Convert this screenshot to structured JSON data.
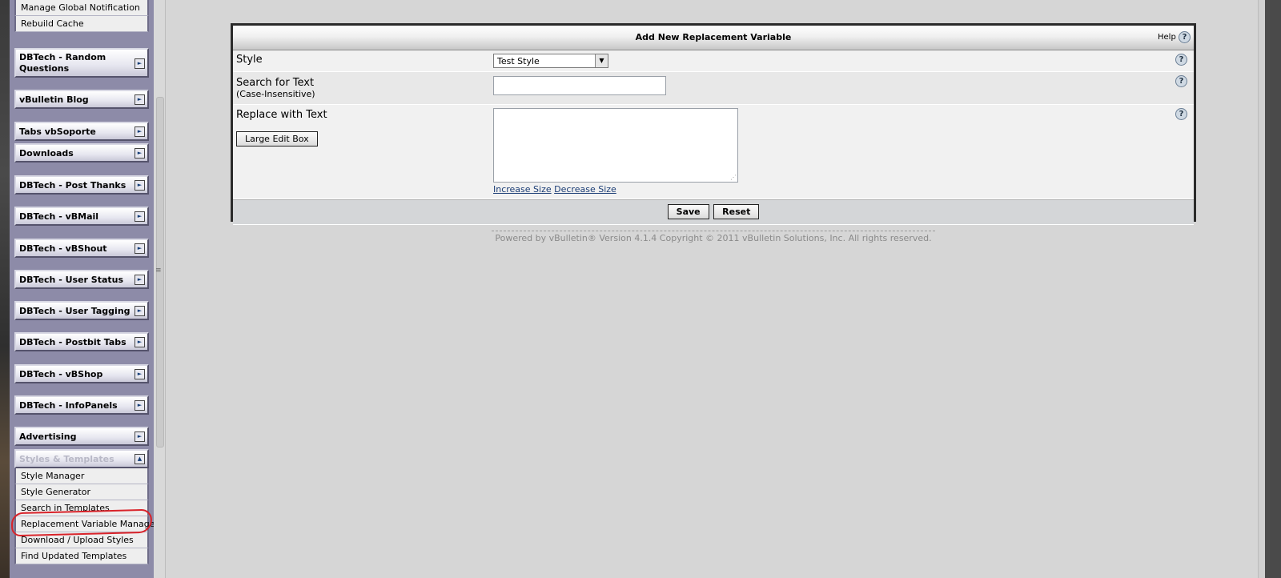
{
  "nav": {
    "top_items": [
      "Manage Global Notification",
      "Rebuild Cache"
    ],
    "groups": [
      {
        "label": "DBTech - Random Questions",
        "toggle": "►"
      },
      {
        "label": "vBulletin Blog",
        "toggle": "►"
      },
      {
        "label": "Tabs vbSoporte",
        "toggle": "►"
      },
      {
        "label": "Downloads",
        "toggle": "►"
      },
      {
        "label": "DBTech - Post Thanks",
        "toggle": "►"
      },
      {
        "label": "DBTech - vBMail",
        "toggle": "►"
      },
      {
        "label": "DBTech - vBShout",
        "toggle": "►"
      },
      {
        "label": "DBTech - User Status",
        "toggle": "►"
      },
      {
        "label": "DBTech - User Tagging",
        "toggle": "►"
      },
      {
        "label": "DBTech - Postbit Tabs",
        "toggle": "►"
      },
      {
        "label": "DBTech - vBShop",
        "toggle": "►"
      },
      {
        "label": "DBTech - InfoPanels",
        "toggle": "►"
      },
      {
        "label": "Advertising",
        "toggle": "►"
      }
    ],
    "open_group": {
      "label": "Styles & Templates",
      "toggle": "▲",
      "items": [
        "Style Manager",
        "Style Generator",
        "Search in Templates",
        "Replacement Variable Manager",
        "Download / Upload Styles",
        "Find Updated Templates"
      ]
    },
    "highlight_color": "#d9232a"
  },
  "form": {
    "title": "Add New Replacement Variable",
    "help_label": "Help",
    "help_icon": "?",
    "style": {
      "label": "Style",
      "value": "Test Style",
      "arrow": "▼"
    },
    "search": {
      "label": "Search for Text",
      "sublabel": "(Case-Insensitive)",
      "value": ""
    },
    "replace": {
      "label": "Replace with Text",
      "value": "",
      "large_edit_label": "Large Edit Box",
      "increase_label": "Increase Size",
      "decrease_label": "Decrease Size"
    },
    "save_label": "Save",
    "reset_label": "Reset"
  },
  "footer": {
    "text": "Powered by vBulletin® Version 4.1.4 Copyright © 2011 vBulletin Solutions, Inc. All rights reserved."
  }
}
